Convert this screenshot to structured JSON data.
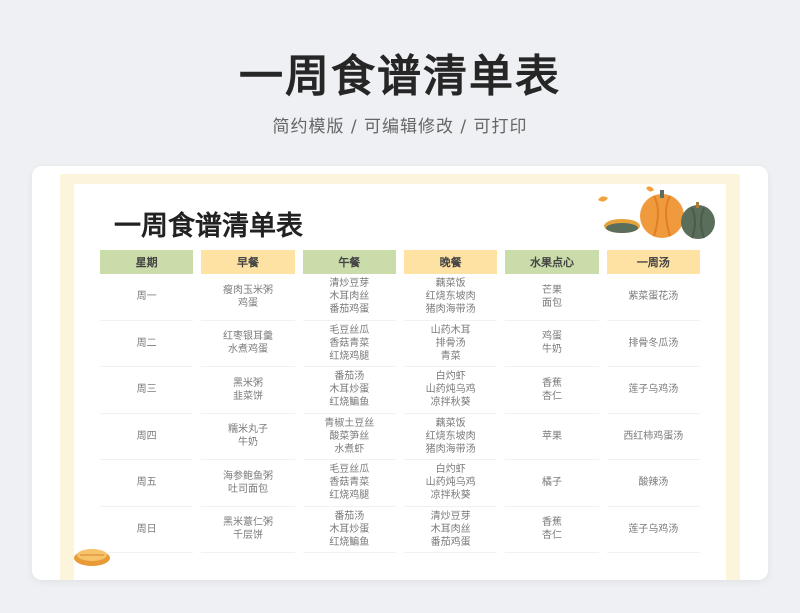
{
  "hero": {
    "title": "一周食谱清单表",
    "subtitle": "简约模版 / 可编辑修改 / 可打印"
  },
  "sheet": {
    "title": "一周食谱清单表",
    "columns": [
      "星期",
      "早餐",
      "午餐",
      "晚餐",
      "水果点心",
      "一周汤"
    ],
    "rows": [
      {
        "day": "周一",
        "breakfast": [
          "瘦肉玉米粥",
          "鸡蛋"
        ],
        "lunch": [
          "清炒豆芽",
          "木耳肉丝",
          "番茄鸡蛋"
        ],
        "dinner": [
          "藕菜饭",
          "红烧东坡肉",
          "猪肉海带汤"
        ],
        "snack": [
          "芒果",
          "面包"
        ],
        "soup": [
          "紫菜蛋花汤"
        ]
      },
      {
        "day": "周二",
        "breakfast": [
          "红枣银耳羹",
          "水煮鸡蛋"
        ],
        "lunch": [
          "毛豆丝瓜",
          "香菇青菜",
          "红烧鸡腿"
        ],
        "dinner": [
          "山药木耳",
          "排骨汤",
          "青菜"
        ],
        "snack": [
          "鸡蛋",
          "牛奶"
        ],
        "soup": [
          "排骨冬瓜汤"
        ]
      },
      {
        "day": "周三",
        "breakfast": [
          "黑米粥",
          "韭菜饼"
        ],
        "lunch": [
          "番茄汤",
          "木耳炒蛋",
          "红烧鳊鱼"
        ],
        "dinner": [
          "白灼虾",
          "山药炖乌鸡",
          "凉拌秋葵"
        ],
        "snack": [
          "香蕉",
          "杏仁"
        ],
        "soup": [
          "莲子乌鸡汤"
        ]
      },
      {
        "day": "周四",
        "breakfast": [
          "糯米丸子",
          "牛奶"
        ],
        "lunch": [
          "青椒土豆丝",
          "酸菜笋丝",
          "水煮虾"
        ],
        "dinner": [
          "藕菜饭",
          "红烧东坡肉",
          "猪肉海带汤"
        ],
        "snack": [
          "苹果"
        ],
        "soup": [
          "西红柿鸡蛋汤"
        ]
      },
      {
        "day": "周五",
        "breakfast": [
          "海参鲍鱼粥",
          "吐司面包"
        ],
        "lunch": [
          "毛豆丝瓜",
          "香菇青菜",
          "红烧鸡腿"
        ],
        "dinner": [
          "白灼虾",
          "山药炖乌鸡",
          "凉拌秋葵"
        ],
        "snack": [
          "橘子"
        ],
        "soup": [
          "酸辣汤"
        ]
      },
      {
        "day": "周日",
        "breakfast": [
          "黑米薏仁粥",
          "千层饼"
        ],
        "lunch": [
          "番茄汤",
          "木耳炒蛋",
          "红烧鳊鱼"
        ],
        "dinner": [
          "清炒豆芽",
          "木耳肉丝",
          "番茄鸡蛋"
        ],
        "snack": [
          "香蕉",
          "杏仁"
        ],
        "soup": [
          "莲子乌鸡汤"
        ]
      }
    ]
  },
  "colors": {
    "header_green": "#c9dca9",
    "header_yellow": "#fde2a3",
    "sheet_frame": "#fdf4dc",
    "pumpkin_orange": "#f3a13a",
    "pumpkin_green": "#5b6e5c"
  },
  "icons": [
    "pumpkin-icon",
    "leaf-icon",
    "pie-icon"
  ]
}
